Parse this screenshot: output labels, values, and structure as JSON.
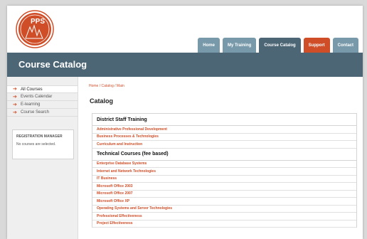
{
  "brand": {
    "logo_text": "PPS",
    "accent": "#cf4e28",
    "banner_color": "#4d6676"
  },
  "nav_tabs": [
    {
      "label": "Home"
    },
    {
      "label": "My Training"
    },
    {
      "label": "Course Catalog",
      "active": true
    },
    {
      "label": "Support"
    },
    {
      "label": "Contact"
    }
  ],
  "banner": {
    "title": "Course Catalog"
  },
  "sidebar": {
    "items": [
      {
        "label": "All Courses",
        "icon": "arrow-right-icon",
        "active": true
      },
      {
        "label": "Events Calendar",
        "icon": "arrow-right-icon"
      },
      {
        "label": "E-learning",
        "icon": "arrow-right-icon"
      },
      {
        "label": "Course Search",
        "icon": "arrow-right-icon"
      }
    ],
    "registration": {
      "title": "REGISTRATION MANAGER",
      "text": "No courses are selected."
    }
  },
  "main": {
    "breadcrumb": "Home / Catalog / Main",
    "title": "Catalog",
    "groups": [
      {
        "title": "District Staff Training",
        "items": [
          "Administrative Professional Development",
          "Business Processes & Technologies",
          "Curriculum and Instruction"
        ]
      },
      {
        "title": "Technical Courses (fee based)",
        "items": [
          "Enterprise Database Systems",
          "Internet and Network Technologies",
          "IT Business",
          "Microsoft Office 2003",
          "Microsoft Office 2007",
          "Microsoft Office XP",
          "Operating Systems and Server Technologies",
          "Professional Effectiveness",
          "Project Effectiveness"
        ]
      }
    ]
  }
}
